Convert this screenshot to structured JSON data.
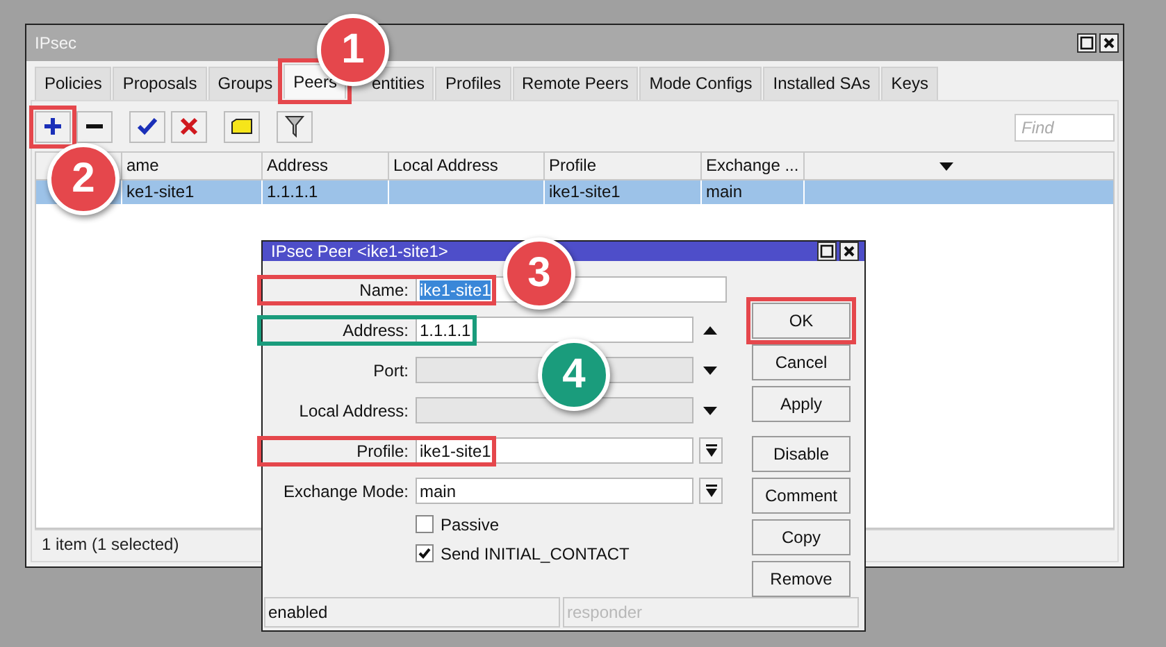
{
  "main_window": {
    "title": "IPsec",
    "tabs": [
      {
        "label": "Policies",
        "selected": false
      },
      {
        "label": "Proposals",
        "selected": false
      },
      {
        "label": "Groups",
        "selected": false
      },
      {
        "label": "Peers",
        "selected": true
      },
      {
        "label": "entities",
        "selected": false
      },
      {
        "label": "Profiles",
        "selected": false
      },
      {
        "label": "Remote Peers",
        "selected": false
      },
      {
        "label": "Mode Configs",
        "selected": false
      },
      {
        "label": "Installed SAs",
        "selected": false
      },
      {
        "label": "Keys",
        "selected": false
      }
    ],
    "find_placeholder": "Find",
    "table": {
      "columns": [
        "ame",
        "Address",
        "Local Address",
        "Profile",
        "Exchange ..."
      ],
      "rows": [
        {
          "cells": [
            "ke1-site1",
            "1.1.1.1",
            null,
            "ike1-site1",
            "main"
          ],
          "selected": true
        }
      ]
    },
    "status_bar": "1 item (1 selected)"
  },
  "dialog": {
    "title": "IPsec Peer <ike1-site1>",
    "fields": [
      {
        "label": "Name:",
        "value": "ike1-site1",
        "kind": "text",
        "disabled": false,
        "value_selected": true
      },
      {
        "label": "Address:",
        "value": "1.1.1.1",
        "kind": "up",
        "disabled": false,
        "value_selected": false
      },
      {
        "label": "Port:",
        "kind": "down",
        "disabled": true
      },
      {
        "label": "Local Address:",
        "kind": "down",
        "disabled": true
      },
      {
        "label": "Profile:",
        "value": "ike1-site1",
        "kind": "select",
        "disabled": false,
        "value_selected": false
      },
      {
        "label": "Exchange Mode:",
        "value": "main",
        "kind": "select",
        "disabled": false,
        "value_selected": false
      }
    ],
    "checkboxes": [
      {
        "label": "Passive",
        "checked": false
      },
      {
        "label": "Send INITIAL_CONTACT",
        "checked": true
      }
    ],
    "buttons": [
      "OK",
      "Cancel",
      "Apply",
      "Disable",
      "Comment",
      "Copy",
      "Remove"
    ],
    "status": [
      {
        "text": "enabled",
        "disabled": false
      },
      {
        "text": "responder",
        "disabled": true
      }
    ]
  },
  "annotations": [
    {
      "label": "1",
      "color": "#e5474c"
    },
    {
      "label": "2",
      "color": "#e5474c"
    },
    {
      "label": "3",
      "color": "#e5474c"
    },
    {
      "label": "4",
      "color": "#1a9c7c"
    }
  ]
}
